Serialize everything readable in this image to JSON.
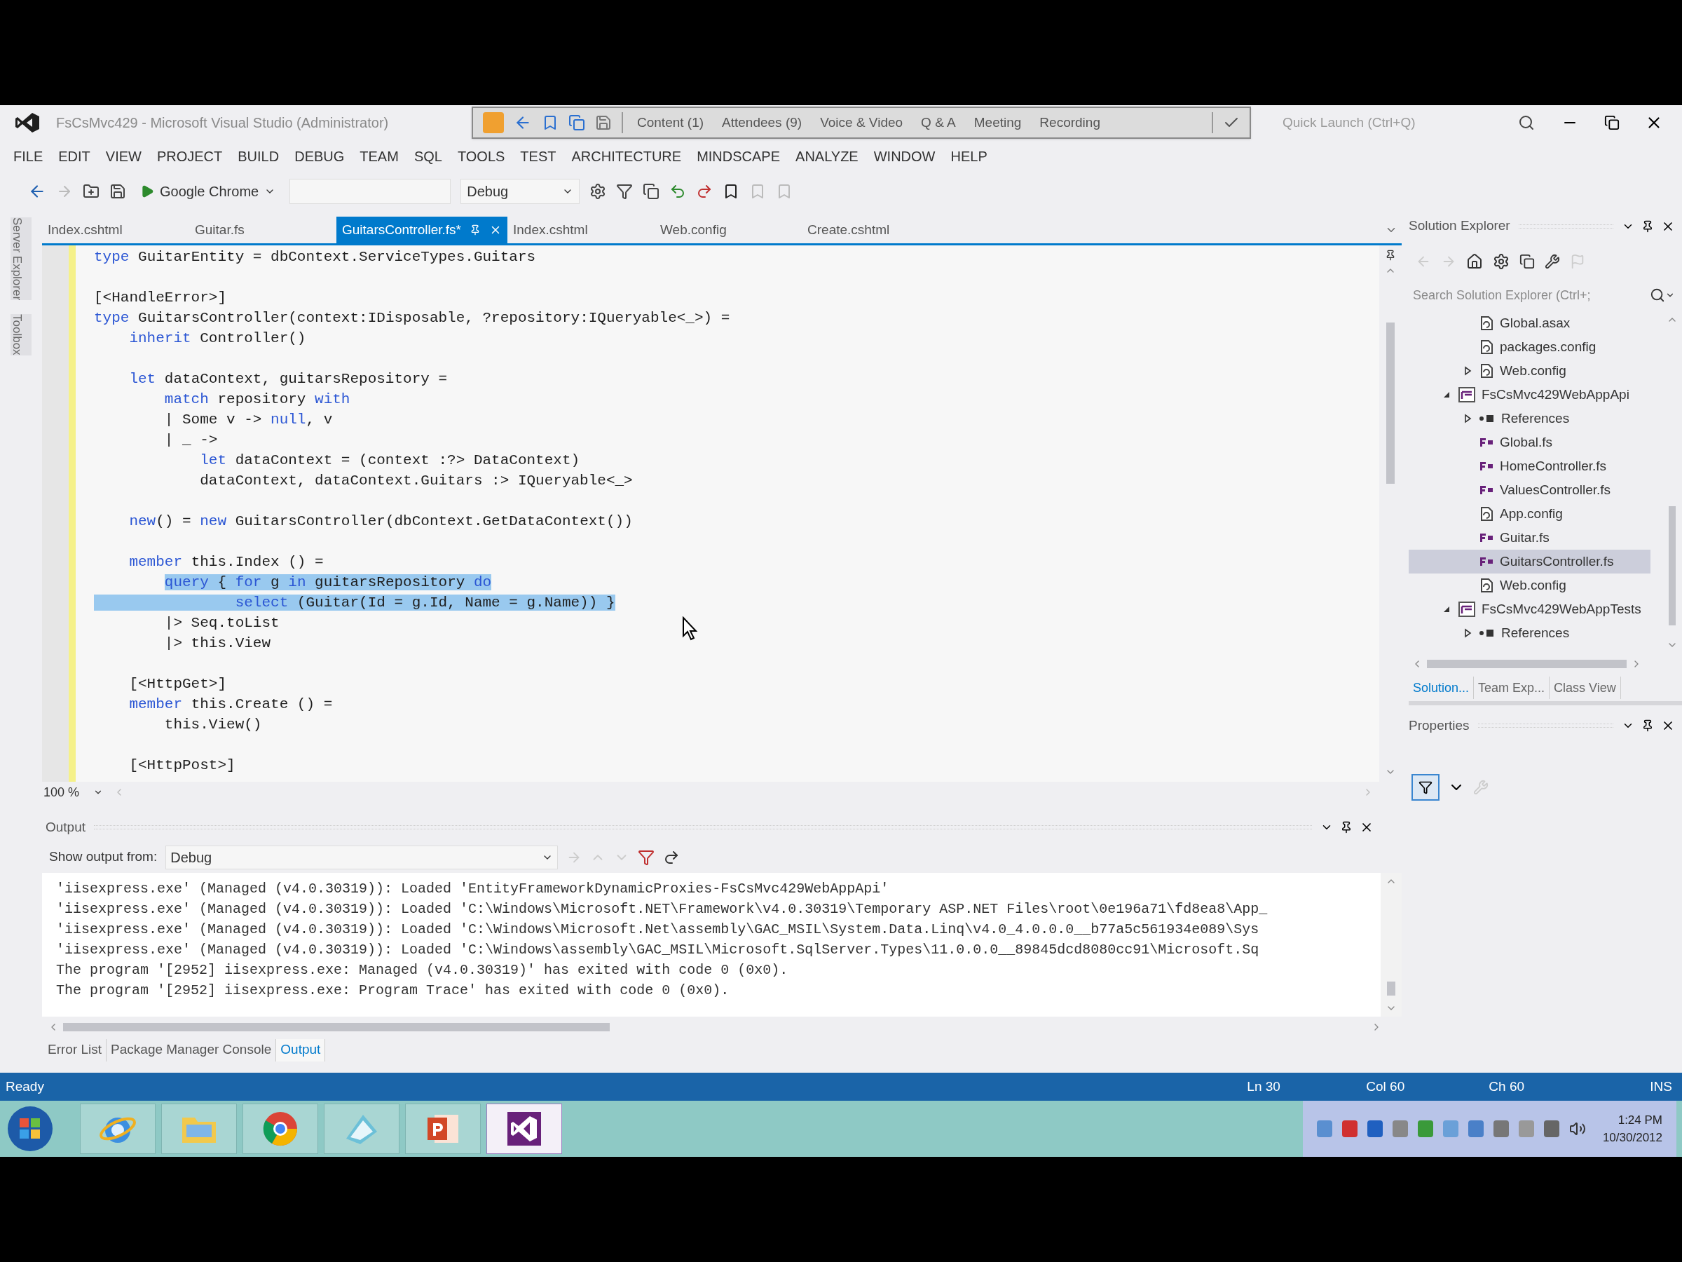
{
  "window": {
    "title": "FsCsMvc429 - Microsoft Visual Studio (Administrator)"
  },
  "meeting_toolbar": {
    "items": [
      "Content (1)",
      "Attendees (9)",
      "Voice & Video",
      "Q & A",
      "Meeting",
      "Recording"
    ]
  },
  "quick_launch": {
    "placeholder": "Quick Launch (Ctrl+Q)"
  },
  "menu": [
    "FILE",
    "EDIT",
    "VIEW",
    "PROJECT",
    "BUILD",
    "DEBUG",
    "TEAM",
    "SQL",
    "TOOLS",
    "TEST",
    "ARCHITECTURE",
    "MINDSCAPE",
    "ANALYZE",
    "WINDOW",
    "HELP"
  ],
  "toolbar": {
    "run_target": "Google Chrome",
    "configuration": "Debug"
  },
  "side_tabs": [
    "Server Explorer",
    "Toolbox"
  ],
  "editor_tabs": [
    {
      "label": "Index.cshtml",
      "selected": false
    },
    {
      "label": "Guitar.fs",
      "selected": false
    },
    {
      "label": "GuitarsController.fs*",
      "selected": true
    },
    {
      "label": "Index.cshtml",
      "selected": false
    },
    {
      "label": "Web.config",
      "selected": false
    },
    {
      "label": "Create.cshtml",
      "selected": false
    }
  ],
  "code_lines": [
    {
      "kind": "code",
      "selected": false,
      "segments": [
        {
          "kind": "keyword",
          "text": "type"
        },
        {
          "kind": "plain",
          "text": " GuitarEntity = dbContext.ServiceTypes.Guitars"
        }
      ]
    },
    {
      "kind": "blank"
    },
    {
      "kind": "code",
      "selected": false,
      "segments": [
        {
          "kind": "plain",
          "text": "[<HandleError>]"
        }
      ]
    },
    {
      "kind": "code",
      "selected": false,
      "segments": [
        {
          "kind": "keyword",
          "text": "type"
        },
        {
          "kind": "plain",
          "text": " GuitarsController(context:IDisposable, ?repository:IQueryable<_>) ="
        }
      ]
    },
    {
      "kind": "code",
      "selected": false,
      "segments": [
        {
          "kind": "keyword",
          "text": "    inherit"
        },
        {
          "kind": "plain",
          "text": " Controller()"
        }
      ]
    },
    {
      "kind": "blank"
    },
    {
      "kind": "code",
      "selected": false,
      "segments": [
        {
          "kind": "keyword",
          "text": "    let"
        },
        {
          "kind": "plain",
          "text": " dataContext, guitarsRepository ="
        }
      ]
    },
    {
      "kind": "code",
      "selected": false,
      "segments": [
        {
          "kind": "keyword",
          "text": "        match"
        },
        {
          "kind": "plain",
          "text": " repository "
        },
        {
          "kind": "keyword",
          "text": "with"
        }
      ]
    },
    {
      "kind": "code",
      "selected": false,
      "segments": [
        {
          "kind": "plain",
          "text": "        | Some v -> "
        },
        {
          "kind": "keyword",
          "text": "null"
        },
        {
          "kind": "plain",
          "text": ", v"
        }
      ]
    },
    {
      "kind": "code",
      "selected": false,
      "segments": [
        {
          "kind": "plain",
          "text": "        | _ ->"
        }
      ]
    },
    {
      "kind": "code",
      "selected": false,
      "segments": [
        {
          "kind": "keyword",
          "text": "            let"
        },
        {
          "kind": "plain",
          "text": " dataContext = (context :?> DataContext)"
        }
      ]
    },
    {
      "kind": "code",
      "selected": false,
      "segments": [
        {
          "kind": "plain",
          "text": "            dataContext, dataContext.Guitars :> IQueryable<_>"
        }
      ]
    },
    {
      "kind": "blank"
    },
    {
      "kind": "code",
      "selected": false,
      "segments": [
        {
          "kind": "keyword",
          "text": "    new"
        },
        {
          "kind": "plain",
          "text": "() = "
        },
        {
          "kind": "keyword",
          "text": "new"
        },
        {
          "kind": "plain",
          "text": " GuitarsController(dbContext.GetDataContext())"
        }
      ]
    },
    {
      "kind": "blank"
    },
    {
      "kind": "code",
      "selected": false,
      "segments": [
        {
          "kind": "keyword",
          "text": "    member"
        },
        {
          "kind": "plain",
          "text": " this.Index () ="
        }
      ]
    },
    {
      "kind": "code",
      "selected": true,
      "segments": [
        {
          "kind": "keyword",
          "text": "        query"
        },
        {
          "kind": "plain",
          "text": " { "
        },
        {
          "kind": "keyword",
          "text": "for"
        },
        {
          "kind": "plain",
          "text": " g "
        },
        {
          "kind": "keyword",
          "text": "in"
        },
        {
          "kind": "plain",
          "text": " guitarsRepository "
        },
        {
          "kind": "keyword",
          "text": "do"
        }
      ]
    },
    {
      "kind": "code",
      "selected": true,
      "segments": [
        {
          "kind": "keyword",
          "text": "                select"
        },
        {
          "kind": "plain",
          "text": " (Guitar(Id = g.Id, Name = g.Name)) }"
        }
      ]
    },
    {
      "kind": "code",
      "selected": false,
      "segments": [
        {
          "kind": "plain",
          "text": "        |> Seq.toList"
        }
      ]
    },
    {
      "kind": "code",
      "selected": false,
      "segments": [
        {
          "kind": "plain",
          "text": "        |> this.View"
        }
      ]
    },
    {
      "kind": "blank"
    },
    {
      "kind": "code",
      "selected": false,
      "segments": [
        {
          "kind": "plain",
          "text": "    [<HttpGet>]"
        }
      ]
    },
    {
      "kind": "code",
      "selected": false,
      "segments": [
        {
          "kind": "keyword",
          "text": "    member"
        },
        {
          "kind": "plain",
          "text": " this.Create () ="
        }
      ]
    },
    {
      "kind": "code",
      "selected": false,
      "segments": [
        {
          "kind": "plain",
          "text": "        this.View()"
        }
      ]
    },
    {
      "kind": "blank"
    },
    {
      "kind": "code",
      "selected": false,
      "segments": [
        {
          "kind": "plain",
          "text": "    [<HttpPost>]"
        }
      ]
    }
  ],
  "zoom": "100 %",
  "output": {
    "title": "Output",
    "source_label": "Show output from:",
    "source": "Debug",
    "lines": [
      "'iisexpress.exe' (Managed (v4.0.30319)): Loaded 'EntityFrameworkDynamicProxies-FsCsMvc429WebAppApi'",
      "'iisexpress.exe' (Managed (v4.0.30319)): Loaded 'C:\\Windows\\Microsoft.NET\\Framework\\v4.0.30319\\Temporary ASP.NET Files\\root\\0e196a71\\fd8ea8\\App_",
      "'iisexpress.exe' (Managed (v4.0.30319)): Loaded 'C:\\Windows\\Microsoft.Net\\assembly\\GAC_MSIL\\System.Data.Linq\\v4.0_4.0.0.0__b77a5c561934e089\\Sys",
      "'iisexpress.exe' (Managed (v4.0.30319)): Loaded 'C:\\Windows\\assembly\\GAC_MSIL\\Microsoft.SqlServer.Types\\11.0.0.0__89845dcd8080cc91\\Microsoft.Sq",
      "The program '[2952] iisexpress.exe: Managed (v4.0.30319)' has exited with code 0 (0x0).",
      "The program '[2952] iisexpress.exe: Program Trace' has exited with code 0 (0x0)."
    ]
  },
  "bottom_tabs": [
    {
      "label": "Error List",
      "selected": false
    },
    {
      "label": "Package Manager Console",
      "selected": false
    },
    {
      "label": "Output",
      "selected": true
    }
  ],
  "solution_explorer": {
    "title": "Solution Explorer",
    "search_placeholder": "Search Solution Explorer (Ctrl+;",
    "items": [
      {
        "kind": "config",
        "label": "Global.asax",
        "selected": false
      },
      {
        "kind": "config",
        "label": "packages.config",
        "selected": false
      },
      {
        "kind": "config",
        "label": "Web.config",
        "selected": false,
        "expanded": false
      },
      {
        "kind": "project",
        "label": "FsCsMvc429WebAppApi",
        "selected": false,
        "expanded": true,
        "children": [
          {
            "kind": "references",
            "label": "References",
            "selected": false,
            "expanded": false
          },
          {
            "kind": "fs",
            "label": "Global.fs",
            "selected": false
          },
          {
            "kind": "fs",
            "label": "HomeController.fs",
            "selected": false
          },
          {
            "kind": "fs",
            "label": "ValuesController.fs",
            "selected": false
          },
          {
            "kind": "config",
            "label": "App.config",
            "selected": false
          },
          {
            "kind": "fs",
            "label": "Guitar.fs",
            "selected": false
          },
          {
            "kind": "fs",
            "label": "GuitarsController.fs",
            "selected": true
          },
          {
            "kind": "config",
            "label": "Web.config",
            "selected": false
          }
        ]
      },
      {
        "kind": "project",
        "label": "FsCsMvc429WebAppTests",
        "selected": false,
        "expanded": true,
        "children": [
          {
            "kind": "references",
            "label": "References",
            "selected": false,
            "expanded": false
          }
        ]
      }
    ],
    "tabs": [
      {
        "label": "Solution...",
        "selected": true
      },
      {
        "label": "Team Exp...",
        "selected": false
      },
      {
        "label": "Class View",
        "selected": false
      }
    ]
  },
  "properties": {
    "title": "Properties"
  },
  "status_bar": {
    "message": "Ready",
    "line": "Ln 30",
    "column": "Col 60",
    "char": "Ch 60",
    "mode": "INS"
  },
  "taskbar": {
    "apps": [
      {
        "kind": "browser",
        "selected": false
      },
      {
        "kind": "folder",
        "selected": false
      },
      {
        "kind": "chrome",
        "selected": false
      },
      {
        "kind": "tool",
        "selected": false
      },
      {
        "kind": "slides",
        "selected": false
      },
      {
        "kind": "studio",
        "selected": true
      }
    ],
    "time": "1:24 PM",
    "date": "10/30/2012"
  }
}
